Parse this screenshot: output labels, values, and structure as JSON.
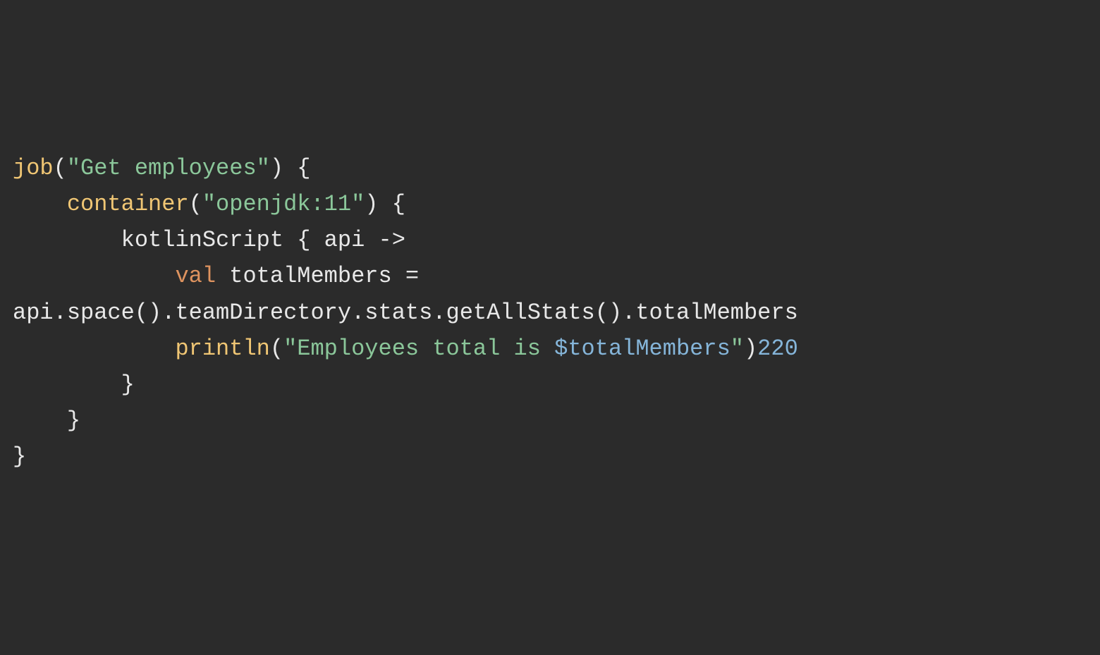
{
  "code": {
    "line1": {
      "job": "job",
      "p1": "(",
      "str": "\"Get employees\"",
      "p2": ") {"
    },
    "line2": {
      "indent": "    ",
      "container": "container",
      "p1": "(",
      "str": "\"openjdk:11\"",
      "p2": ") {"
    },
    "line3": {
      "indent": "        ",
      "text": "kotlinScript { api ->"
    },
    "line4": {
      "indent": "            ",
      "val": "val",
      "rest": " totalMembers ="
    },
    "line5": {
      "text": "api.space().teamDirectory.stats.getAllStats().totalMembers"
    },
    "line6": {
      "indent": "            ",
      "println": "println",
      "p1": "(",
      "strPre": "\"Employees total is ",
      "tmpl": "$totalMembers",
      "strPost": "\"",
      "p2": ")",
      "num": "220"
    },
    "line7": {
      "indent": "        ",
      "brace": "}"
    },
    "line8": {
      "indent": "    ",
      "brace": "}"
    },
    "line9": {
      "brace": "}"
    }
  }
}
